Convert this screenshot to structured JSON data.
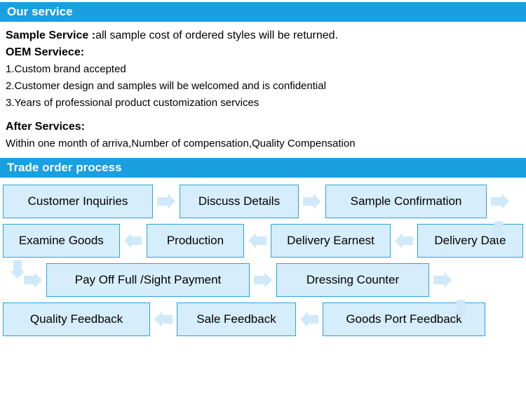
{
  "service": {
    "header": "Our service",
    "lines": [
      {
        "bold": "Sample Service :",
        "rest": "all sample cost of ordered styles will be returned."
      },
      {
        "bold": "OEM Serviece:",
        "rest": ""
      },
      {
        "bold": "",
        "rest": "1.Custom brand accepted"
      },
      {
        "bold": "",
        "rest": "2.Customer design and samples will be welcomed and is confidential"
      },
      {
        "bold": "",
        "rest": "3.Years of professional product customization services"
      },
      {
        "bold": "After Services:",
        "rest": ""
      },
      {
        "bold": "",
        "rest": "Within one month of arriva,Number of compensation,Quality Compensation"
      }
    ]
  },
  "process": {
    "header": "Trade order process",
    "row1": [
      "Customer Inquiries",
      "Discuss Details",
      "Sample Confirmation"
    ],
    "row2": [
      "Examine Goods",
      "Production",
      "Delivery Earnest",
      "Delivery Date"
    ],
    "row3": [
      "Pay Off Full /Sight Payment",
      "Dressing Counter"
    ],
    "row4": [
      "Quality Feedback",
      "Sale Feedback",
      "Goods Port Feedback"
    ]
  },
  "colors": {
    "accent": "#1a9fe0",
    "box_fill": "#d6edfb",
    "box_border": "#2aa3e0",
    "arrow_fill": "#cfe9fa"
  }
}
